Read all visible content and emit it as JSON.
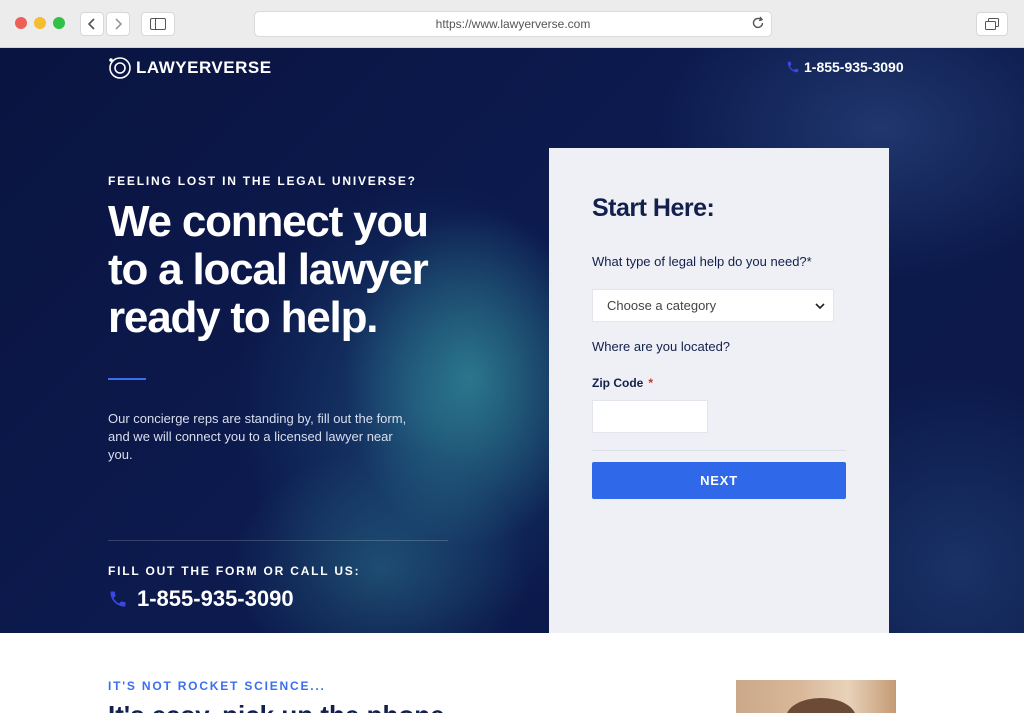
{
  "browser": {
    "url": "https://www.lawyerverse.com"
  },
  "header": {
    "logo_text": "LAWYERVERSE",
    "phone": "1-855-935-3090"
  },
  "hero": {
    "eyebrow": "FEELING LOST IN THE LEGAL UNIVERSE?",
    "headline": "We connect you to a local lawyer ready to help.",
    "description": "Our concierge reps are standing by, fill out the form, and we will connect you to a licensed lawyer near you.",
    "cta_label": "FILL OUT THE FORM OR CALL US:",
    "cta_phone": "1-855-935-3090"
  },
  "form": {
    "title": "Start Here:",
    "question_help": "What type of legal help do you need?*",
    "category_select": "Choose a category",
    "question_location": "Where are you located?",
    "zip_label": "Zip Code",
    "zip_required": "*",
    "zip_value": "",
    "next_label": "NEXT"
  },
  "section": {
    "eyebrow": "IT'S NOT ROCKET SCIENCE...",
    "heading": "It's easy, pick up the phone"
  },
  "colors": {
    "accent_blue": "#3068ea",
    "navy_text": "#13204d",
    "hero_bg": "#0c1a4e",
    "card_bg": "#eef0f5"
  }
}
